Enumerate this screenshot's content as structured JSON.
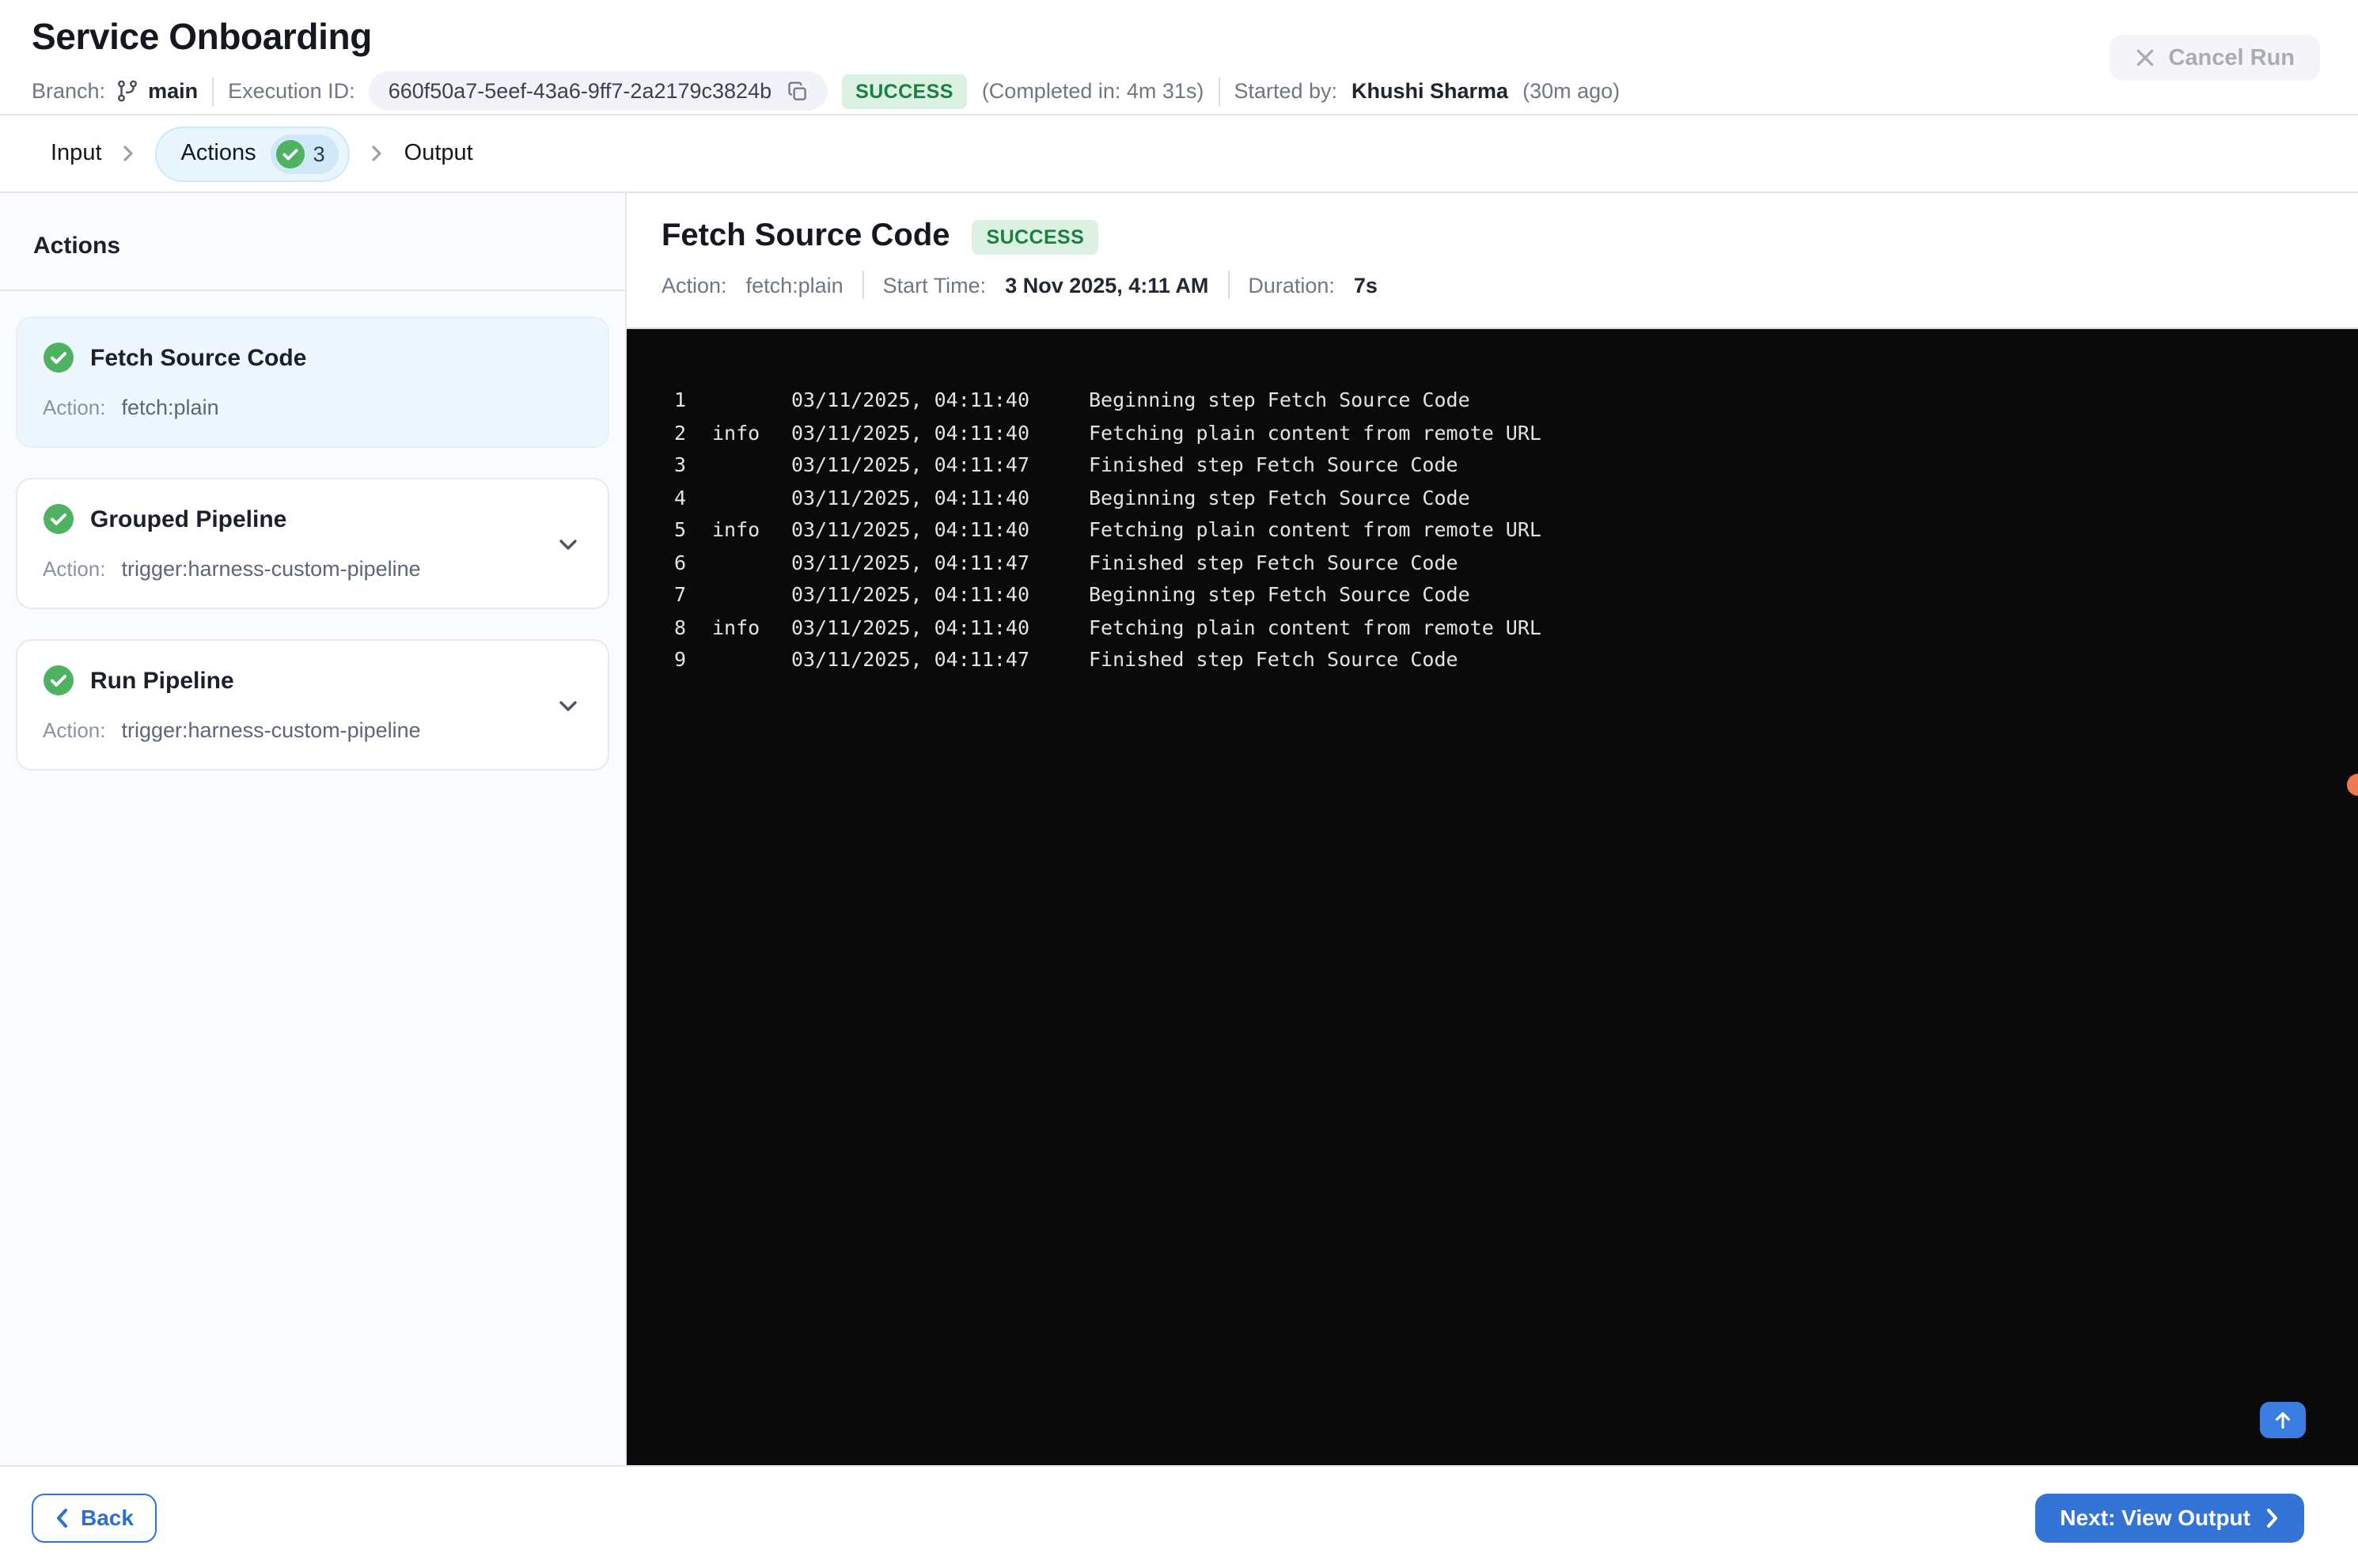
{
  "header": {
    "title": "Service Onboarding",
    "branch_label": "Branch:",
    "branch": "main",
    "execution_id_label": "Execution ID:",
    "execution_id": "660f50a7-5eef-43a6-9ff7-2a2179c3824b",
    "status": "SUCCESS",
    "completed_in": "(Completed in: 4m 31s)",
    "started_by_label": "Started by:",
    "started_by": "Khushi Sharma",
    "started_ago": "(30m ago)",
    "cancel_label": "Cancel Run"
  },
  "tabs": {
    "input": "Input",
    "actions": "Actions",
    "actions_count": "3",
    "output": "Output"
  },
  "sidebar": {
    "heading": "Actions",
    "items": [
      {
        "title": "Fetch Source Code",
        "action_label": "Action:",
        "action": "fetch:plain",
        "status": "success",
        "selected": true,
        "expandable": false
      },
      {
        "title": "Grouped Pipeline",
        "action_label": "Action:",
        "action": "trigger:harness-custom-pipeline",
        "status": "success",
        "selected": false,
        "expandable": true
      },
      {
        "title": "Run Pipeline",
        "action_label": "Action:",
        "action": "trigger:harness-custom-pipeline",
        "status": "success",
        "selected": false,
        "expandable": true
      }
    ]
  },
  "detail": {
    "title": "Fetch Source Code",
    "status": "SUCCESS",
    "action_label": "Action:",
    "action_value": "fetch:plain",
    "start_label": "Start Time:",
    "start_value": "3 Nov 2025, 4:11 AM",
    "duration_label": "Duration:",
    "duration_value": "7s"
  },
  "console": {
    "lines": [
      {
        "num": "1",
        "level": "",
        "time": "03/11/2025, 04:11:40",
        "msg": "Beginning step Fetch Source Code"
      },
      {
        "num": "2",
        "level": "info",
        "time": "03/11/2025, 04:11:40",
        "msg": "Fetching plain content from remote URL"
      },
      {
        "num": "3",
        "level": "",
        "time": "03/11/2025, 04:11:47",
        "msg": "Finished step Fetch Source Code"
      },
      {
        "num": "4",
        "level": "",
        "time": "03/11/2025, 04:11:40",
        "msg": "Beginning step Fetch Source Code"
      },
      {
        "num": "5",
        "level": "info",
        "time": "03/11/2025, 04:11:40",
        "msg": "Fetching plain content from remote URL"
      },
      {
        "num": "6",
        "level": "",
        "time": "03/11/2025, 04:11:47",
        "msg": "Finished step Fetch Source Code"
      },
      {
        "num": "7",
        "level": "",
        "time": "03/11/2025, 04:11:40",
        "msg": "Beginning step Fetch Source Code"
      },
      {
        "num": "8",
        "level": "info",
        "time": "03/11/2025, 04:11:40",
        "msg": "Fetching plain content from remote URL"
      },
      {
        "num": "9",
        "level": "",
        "time": "03/11/2025, 04:11:47",
        "msg": "Finished step Fetch Source Code"
      }
    ]
  },
  "footer": {
    "back_label": "Back",
    "next_label": "Next: View Output"
  },
  "icons": {
    "git_branch": "git-branch",
    "copy": "copy",
    "check_circle": "check-circle",
    "chevron_right": "›",
    "chevron_down": "⌄",
    "chevron_left": "‹",
    "close": "✕",
    "arrow_up": "↑"
  },
  "colors": {
    "accent_blue": "#3374d4",
    "back_border_blue": "#2f72dd",
    "success_text": "#1a8044",
    "success_bg": "#dcf1e1",
    "check_green": "#4fb261",
    "tab_pill_bg": "#e9f6fe",
    "tab_count_bg": "#cfe9f9",
    "selected_card_bg": "#edf7fd",
    "console_bg": "#0a0a0b",
    "console_text": "#e3e3e3",
    "cursor_dot": "#ef7a4e",
    "disabled_btn_bg": "#f5f5f9",
    "disabled_btn_text": "#a9abb6"
  }
}
